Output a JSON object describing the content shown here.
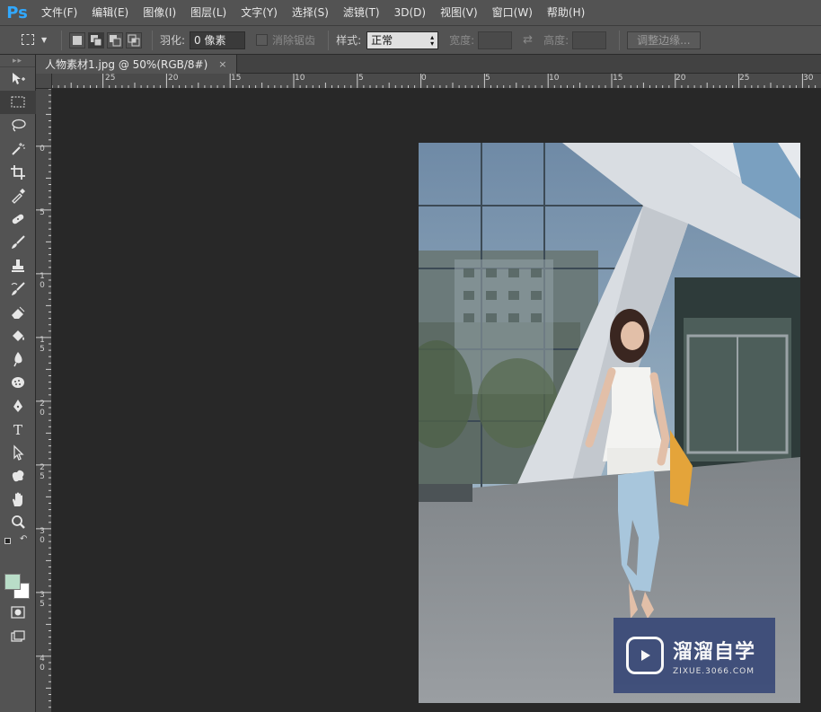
{
  "app": {
    "logo": "Ps",
    "accent_color": "#31a8ff"
  },
  "menu": [
    {
      "label": "文件(F)"
    },
    {
      "label": "编辑(E)"
    },
    {
      "label": "图像(I)"
    },
    {
      "label": "图层(L)"
    },
    {
      "label": "文字(Y)"
    },
    {
      "label": "选择(S)"
    },
    {
      "label": "滤镜(T)"
    },
    {
      "label": "3D(D)"
    },
    {
      "label": "视图(V)"
    },
    {
      "label": "窗口(W)"
    },
    {
      "label": "帮助(H)"
    }
  ],
  "options": {
    "feather_label": "羽化:",
    "feather_value": "0 像素",
    "antialias_label": "消除锯齿",
    "style_label": "样式:",
    "style_value": "正常",
    "width_label": "宽度:",
    "height_label": "高度:",
    "refine_edge_label": "调整边缘..."
  },
  "document": {
    "tab_title": "人物素材1.jpg @ 50%(RGB/8#)",
    "close_glyph": "×"
  },
  "ruler_h_labels": [
    "25",
    "20",
    "15",
    "10",
    "5",
    "0",
    "5",
    "10",
    "15",
    "20",
    "25",
    "30"
  ],
  "ruler_v_labels": [
    "0",
    "5",
    "1 0",
    "1 5",
    "2 0",
    "2 5",
    "3 0",
    "3 5",
    "4 0"
  ],
  "colors": {
    "foreground": "#b9ddc8",
    "background": "#ffffff"
  },
  "watermark": {
    "title": "溜溜自学",
    "subtitle": "ZIXUE.3066.COM"
  }
}
